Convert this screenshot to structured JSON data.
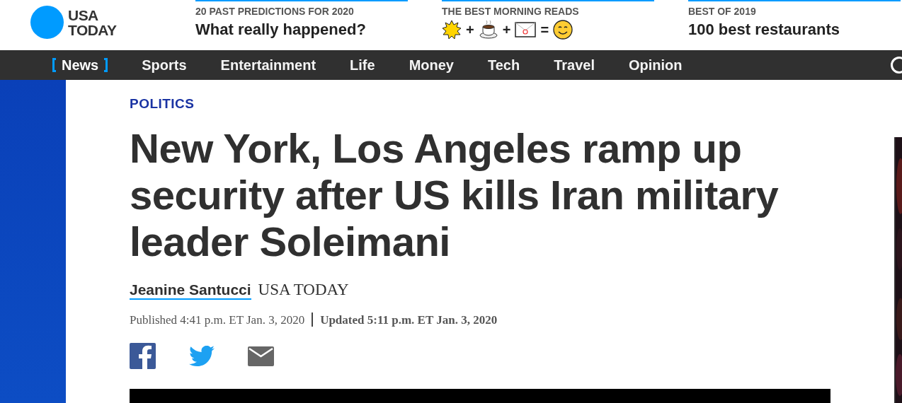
{
  "logo": {
    "text": "USA TODAY"
  },
  "promos": [
    {
      "kicker": "20 PAST PREDICTIONS FOR 2020",
      "headline": "What really happened?"
    },
    {
      "kicker": "THE BEST MORNING READS",
      "equation": [
        {
          "kind": "sun"
        },
        {
          "kind": "operator",
          "text": "+"
        },
        {
          "kind": "coffee"
        },
        {
          "kind": "operator",
          "text": "+"
        },
        {
          "kind": "envelope"
        },
        {
          "kind": "operator",
          "text": "="
        },
        {
          "kind": "smile"
        }
      ]
    },
    {
      "kicker": "BEST OF 2019",
      "headline": "100 best restaurants"
    }
  ],
  "nav": [
    {
      "label": "News",
      "selected": true
    },
    {
      "label": "Sports",
      "selected": false
    },
    {
      "label": "Entertainment",
      "selected": false
    },
    {
      "label": "Life",
      "selected": false
    },
    {
      "label": "Money",
      "selected": false
    },
    {
      "label": "Tech",
      "selected": false
    },
    {
      "label": "Travel",
      "selected": false
    },
    {
      "label": "Opinion",
      "selected": false
    }
  ],
  "article": {
    "section": "POLITICS",
    "headline": "New York, Los Angeles ramp up security after US kills Iran military leader Soleimani",
    "author": "Jeanine Santucci",
    "outlet": "USA TODAY",
    "published": "Published 4:41 p.m. ET Jan. 3, 2020",
    "updated": "Updated 5:11 p.m. ET Jan. 3, 2020",
    "share": [
      {
        "kind": "facebook"
      },
      {
        "kind": "twitter"
      },
      {
        "kind": "email"
      }
    ]
  }
}
